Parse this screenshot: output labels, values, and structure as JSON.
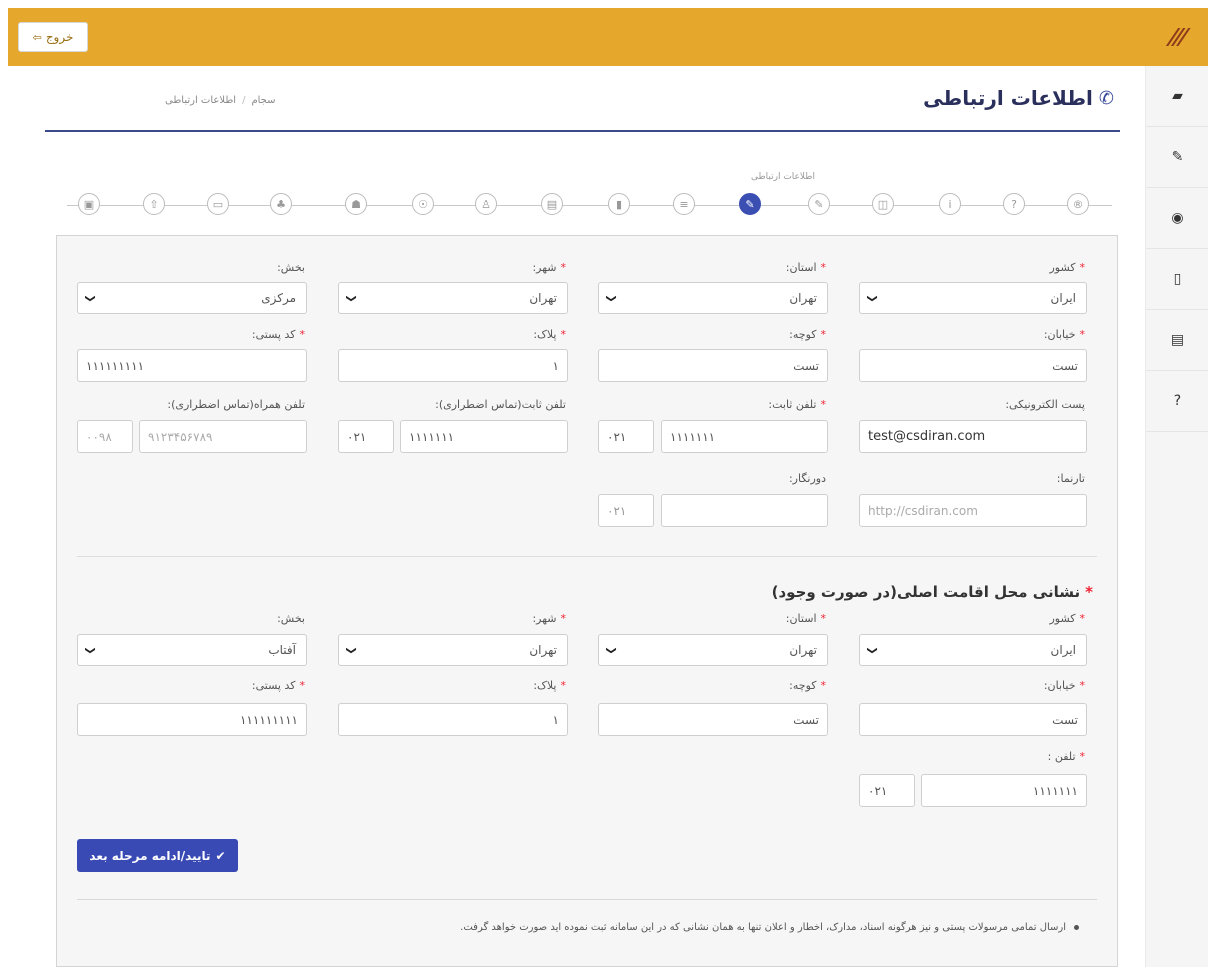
{
  "topbar": {
    "logout_label": "خروج"
  },
  "header": {
    "title": "اطلاعات ارتباطی",
    "breadcrumb": [
      "سجام",
      "اطلاعات ارتباطی"
    ]
  },
  "sidebar": {
    "items": [
      {
        "icon": "book-icon",
        "glyph": "▰"
      },
      {
        "icon": "edit-icon",
        "glyph": "✎"
      },
      {
        "icon": "eye-icon",
        "glyph": "◉"
      },
      {
        "icon": "mobile-icon",
        "glyph": "▯"
      },
      {
        "icon": "calculator-icon",
        "glyph": "▤"
      },
      {
        "icon": "question-icon",
        "glyph": "?"
      }
    ]
  },
  "stepper": {
    "active_label": "اطلاعات ارتباطی",
    "steps": [
      {
        "icon": "id-card-icon",
        "glyph": "▣"
      },
      {
        "icon": "upload-icon",
        "glyph": "⇧"
      },
      {
        "icon": "credit-card-icon",
        "glyph": "▭"
      },
      {
        "icon": "binoculars-icon",
        "glyph": "♣"
      },
      {
        "icon": "users-icon",
        "glyph": "☗"
      },
      {
        "icon": "handshake-icon",
        "glyph": "☉"
      },
      {
        "icon": "sitemap-icon",
        "glyph": "♙"
      },
      {
        "icon": "address-card-icon",
        "glyph": "▤"
      },
      {
        "icon": "bookmark-icon",
        "glyph": "▮"
      },
      {
        "icon": "list-icon",
        "glyph": "≡"
      },
      {
        "icon": "edit-icon",
        "glyph": "✎",
        "active": true
      },
      {
        "icon": "edit-icon",
        "glyph": "✎"
      },
      {
        "icon": "money-icon",
        "glyph": "◫"
      },
      {
        "icon": "info-icon",
        "glyph": "i"
      },
      {
        "icon": "question-icon",
        "glyph": "?"
      },
      {
        "icon": "registered-icon",
        "glyph": "®"
      }
    ]
  },
  "form": {
    "country_label": "کشور",
    "country_value": "ایران",
    "province_label": "استان:",
    "province_value": "تهران",
    "city_label": "شهر:",
    "city_value": "تهران",
    "district_label": "بخش:",
    "district_value": "مرکزی",
    "street_label": "خیابان:",
    "street_value": "تست",
    "alley_label": "کوچه:",
    "alley_value": "تست",
    "plaque_label": "پلاک:",
    "plaque_value": "۱",
    "postal_label": "کد پستی:",
    "postal_value": "۱۱۱۱۱۱۱۱۱",
    "email_label": "پست الکترونیکی:",
    "email_value": "test@csdiran.com",
    "phone_label": "تلفن ثابت:",
    "phone_code": "۰۲۱",
    "phone_value": "۱۱۱۱۱۱۱",
    "emergency_phone_label": "تلفن ثابت(تماس اضطراری):",
    "emergency_phone_code": "۰۲۱",
    "emergency_phone_value": "۱۱۱۱۱۱۱",
    "emergency_mobile_label": "تلفن همراه(تماس اضطراری):",
    "emergency_mobile_code": "۰۰۹۸",
    "emergency_mobile_value": "۹۱۲۳۴۵۶۷۸۹",
    "website_label": "تارنما:",
    "website_placeholder": "http://csdiran.com",
    "fax_label": "دورنگار:",
    "fax_code": "۰۲۱",
    "fax_value": ""
  },
  "residence": {
    "title": "نشانی محل اقامت اصلی(در صورت وجود)",
    "country_label": "کشور",
    "country_value": "ایران",
    "province_label": "استان:",
    "province_value": "تهران",
    "city_label": "شهر:",
    "city_value": "تهران",
    "district_label": "بخش:",
    "district_value": "آفتاب",
    "street_label": "خیابان:",
    "street_value": "تست",
    "alley_label": "کوچه:",
    "alley_value": "تست",
    "plaque_label": "پلاک:",
    "plaque_value": "۱",
    "postal_label": "کد پستی:",
    "postal_value": "۱۱۱۱۱۱۱۱۱",
    "phone_label": "تلفن :",
    "phone_code": "۰۲۱",
    "phone_value": "۱۱۱۱۱۱۱"
  },
  "submit_label": "تایید/ادامه مرحله بعد",
  "note": "ارسال تمامی مرسولات پستی و نیز هرگونه اسناد، مدارک، اخطار و اعلان تنها به همان نشانی که در این سامانه ثبت نموده اید صورت خواهد گرفت."
}
